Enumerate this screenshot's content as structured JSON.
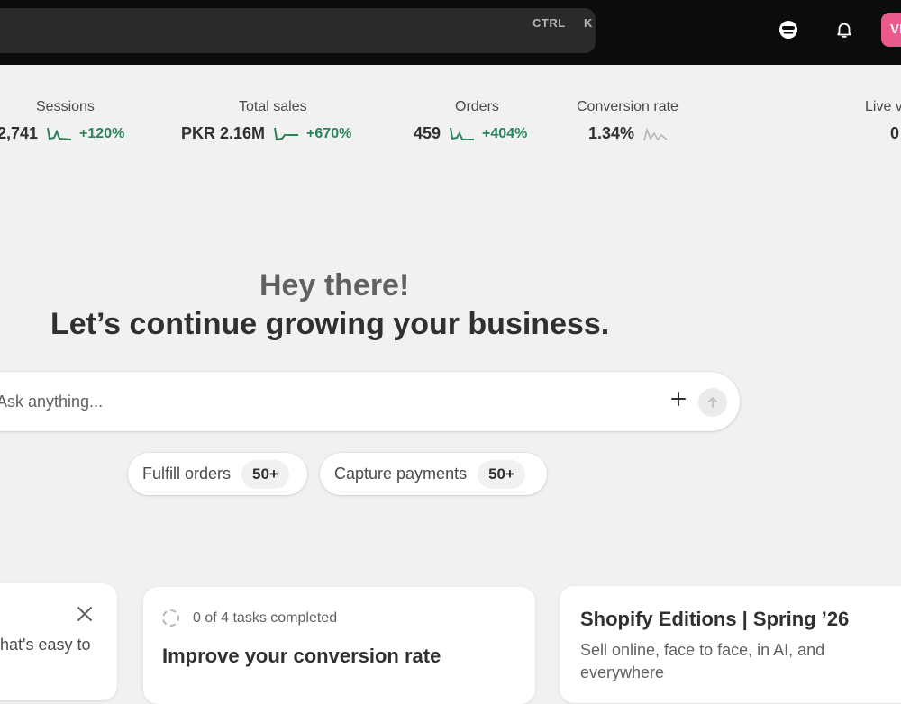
{
  "search": {
    "shortcut_ctrl": "CTRL",
    "shortcut_key": "K"
  },
  "header": {
    "avatar_initials": "VI",
    "store_icon": "store-icon",
    "bell_icon": "bell-icon"
  },
  "metrics": [
    {
      "label": "Sessions",
      "value": "2,741",
      "change": "+120%"
    },
    {
      "label": "Total sales",
      "value": "PKR 2.16M",
      "change": "+670%"
    },
    {
      "label": "Orders",
      "value": "459",
      "change": "+404%"
    },
    {
      "label": "Conversion rate",
      "value": "1.34%",
      "change": ""
    },
    {
      "label": "Live v",
      "value": "0",
      "change": ""
    }
  ],
  "hero": {
    "greeting": "Hey there!",
    "subtitle": "Let’s continue growing your business."
  },
  "ask": {
    "placeholder": "Ask anything..."
  },
  "chips": [
    {
      "label": "Fulfill orders",
      "count": "50+"
    },
    {
      "label": "Capture payments",
      "count": "50+"
    }
  ],
  "cards": {
    "left": {
      "text": "hat's easy to"
    },
    "setup": {
      "progress": "0 of 4 tasks completed",
      "title": "Improve your conversion rate"
    },
    "editions": {
      "title": "Shopify Editions | Spring ’26",
      "description": "Sell online, face to face, in AI, and everywhere"
    }
  },
  "colors": {
    "positive": "#29845a",
    "avatar": "#ea5a8c",
    "topbar": "#0c0c0c"
  }
}
